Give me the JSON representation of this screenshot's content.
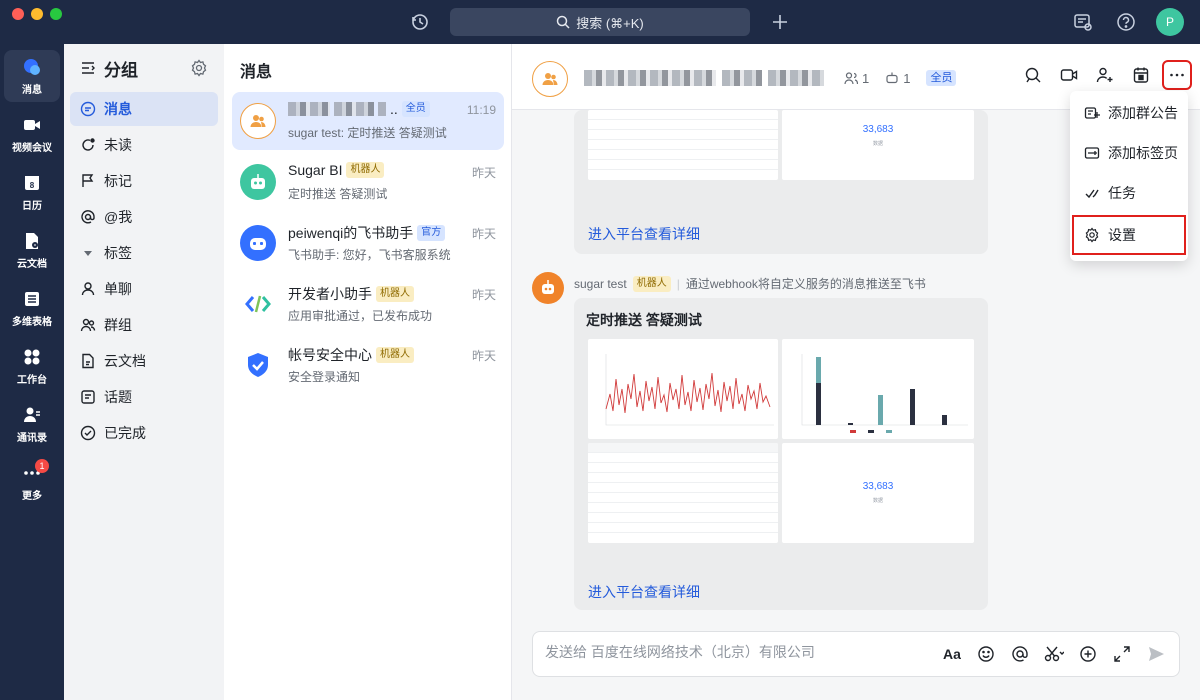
{
  "titlebar": {
    "search_label": "搜索 (⌘+K)",
    "avatar_letter": "P"
  },
  "rail": {
    "items": [
      {
        "label": "消息",
        "icon": "chat-bubble-icon",
        "active": true
      },
      {
        "label": "视频会议",
        "icon": "video-camera-icon"
      },
      {
        "label": "日历",
        "icon": "calendar-icon",
        "day": "8"
      },
      {
        "label": "云文档",
        "icon": "cloud-doc-icon"
      },
      {
        "label": "多维表格",
        "icon": "base-table-icon"
      },
      {
        "label": "工作台",
        "icon": "workspace-grid-icon"
      },
      {
        "label": "通讯录",
        "icon": "contacts-icon"
      },
      {
        "label": "更多",
        "icon": "more-dots-icon",
        "badge": "1"
      }
    ]
  },
  "groups": {
    "title": "分组",
    "items": [
      {
        "label": "消息",
        "icon": "message-icon",
        "active": true
      },
      {
        "label": "未读",
        "icon": "unread-icon"
      },
      {
        "label": "标记",
        "icon": "flag-icon"
      },
      {
        "label": "@我",
        "icon": "at-icon"
      },
      {
        "label": "标签",
        "icon": "triangle-down-icon"
      },
      {
        "label": "单聊",
        "icon": "person-icon"
      },
      {
        "label": "群组",
        "icon": "group-icon"
      },
      {
        "label": "云文档",
        "icon": "doc-icon"
      },
      {
        "label": "话题",
        "icon": "topic-icon"
      },
      {
        "label": "已完成",
        "icon": "check-circle-icon"
      }
    ]
  },
  "message_list": {
    "title": "消息",
    "conversations": [
      {
        "name": "",
        "tag": "全员",
        "preview": "sugar test: 定时推送 答疑测试",
        "time": "11:19"
      },
      {
        "name": "Sugar BI",
        "tag": "机器人",
        "preview": "定时推送 答疑测试",
        "time": "昨天"
      },
      {
        "name": "peiwenqi的飞书助手",
        "tag": "官方",
        "preview": "飞书助手: 您好，飞书客服系统",
        "time": "昨天"
      },
      {
        "name": "开发者小助手",
        "tag": "机器人",
        "preview": "应用审批通过，已发布成功",
        "time": "昨天"
      },
      {
        "name": "帐号安全中心",
        "tag": "机器人",
        "preview": "安全登录通知",
        "time": "昨天"
      }
    ]
  },
  "chat": {
    "member_count": "1",
    "bot_count": "1",
    "tag": "全员",
    "card1": {
      "number": "33,683",
      "number_label": "数据",
      "link": "进入平台查看详细"
    },
    "sender": {
      "name": "sugar test",
      "tag": "机器人",
      "note": "通过webhook将自定义服务的消息推送至飞书"
    },
    "card2": {
      "title": "定时推送 答疑测试",
      "number": "33,683",
      "number_label": "数据",
      "link": "进入平台查看详细"
    },
    "composer_placeholder": "发送给 百度在线网络技术（北京）有限公司"
  },
  "dropdown": {
    "items": [
      {
        "label": "添加群公告",
        "icon": "announcement-icon"
      },
      {
        "label": "添加标签页",
        "icon": "add-tab-icon"
      },
      {
        "label": "任务",
        "icon": "task-check-icon"
      },
      {
        "label": "设置",
        "icon": "settings-gear-icon",
        "highlighted": true
      }
    ]
  }
}
